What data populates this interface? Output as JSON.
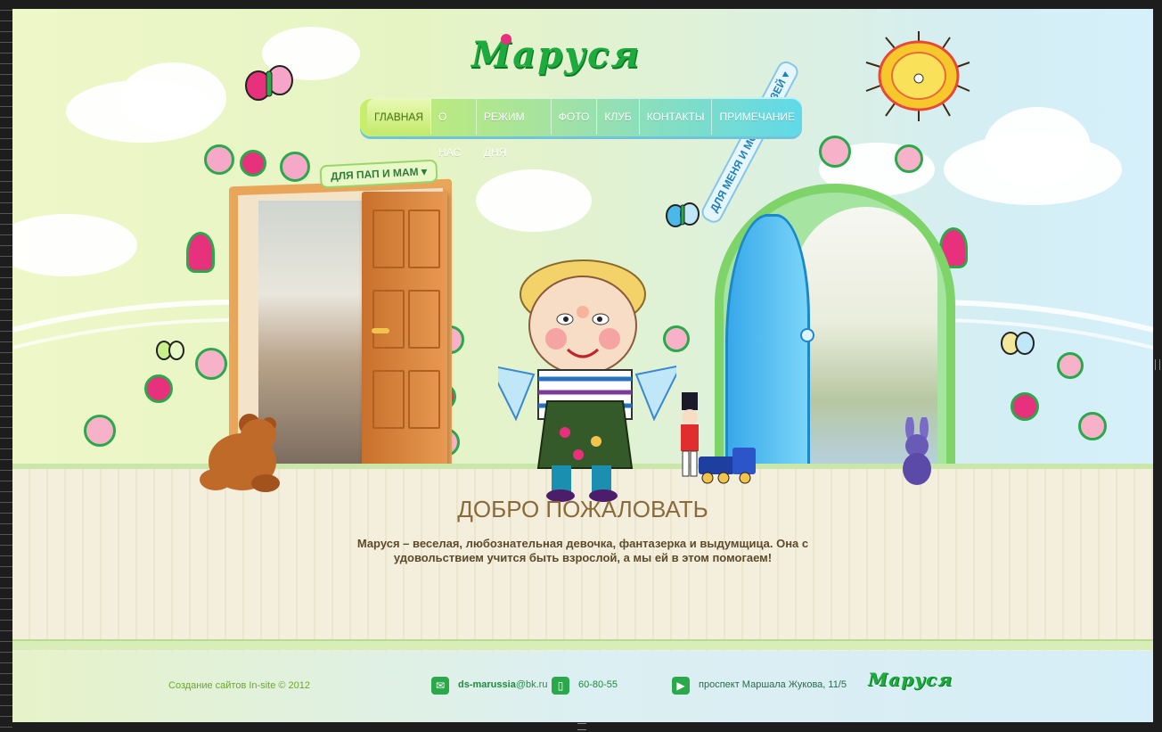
{
  "logo": {
    "text": "Маруся"
  },
  "nav": {
    "items": [
      {
        "label": "ГЛАВНАЯ",
        "active": true
      },
      {
        "label": "О НАС"
      },
      {
        "label": "РЕЖИМ ДНЯ"
      },
      {
        "label": "ФОТО"
      },
      {
        "label": "КЛУБ"
      },
      {
        "label": "КОНТАКТЫ"
      },
      {
        "label": "ПРИМЕЧАНИЕ"
      }
    ]
  },
  "doors": {
    "left_label": "ДЛЯ ПАП И МАМ ▾",
    "right_label": "ДЛЯ МЕНЯ И МОИХ ДРУЗЕЙ ▾"
  },
  "main": {
    "title": "ДОБРО ПОЖАЛОВАТЬ",
    "intro": "Маруся – веселая, любознательная девочка, фантазерка и выдумщица. Она с удовольствием учится быть взрослой, а мы ей в этом помогаем!"
  },
  "footer": {
    "credits": "Создание сайтов In-site © 2012",
    "email_user": "ds-marussia",
    "email_domain": "@bk.ru",
    "phone": "60-80-55",
    "address": "проспект Маршала Жукова, 11/5",
    "logo": "Маруся"
  },
  "colors": {
    "brand_green": "#1cab3c",
    "nav_active": "#c4ea6a",
    "nav_end": "#5fd9e9",
    "title_brown": "#8a6a3a"
  }
}
